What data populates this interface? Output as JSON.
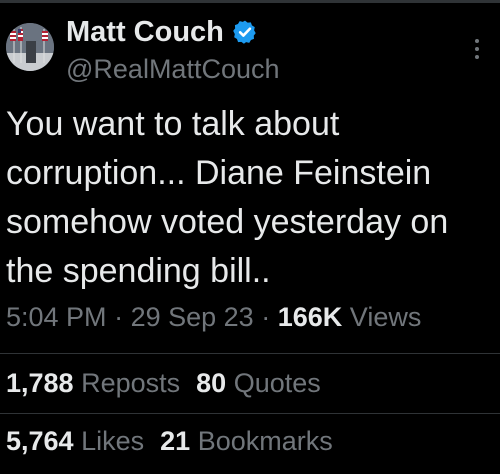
{
  "tweet": {
    "author": {
      "display_name": "Matt Couch",
      "handle": "@RealMattCouch",
      "verified": true,
      "avatar_icon": "avatar-flags-image"
    },
    "text": "You want to talk about\ncorruption... Diane Feinstein\nsomehow voted yesterday on\nthe spending bill..",
    "time": "5:04 PM",
    "date": "29 Sep 23",
    "separator": "·",
    "views_count": "166K",
    "views_label": "Views",
    "reposts_count": "1,788",
    "reposts_label": "Reposts",
    "quotes_count": "80",
    "quotes_label": "Quotes",
    "likes_count": "5,764",
    "likes_label": "Likes",
    "bookmarks_count": "21",
    "bookmarks_label": "Bookmarks"
  },
  "colors": {
    "background": "#000000",
    "text": "#e7e9ea",
    "secondary": "#71767b",
    "verified_badge": "#1d9bf0",
    "divider": "#2f3336"
  }
}
